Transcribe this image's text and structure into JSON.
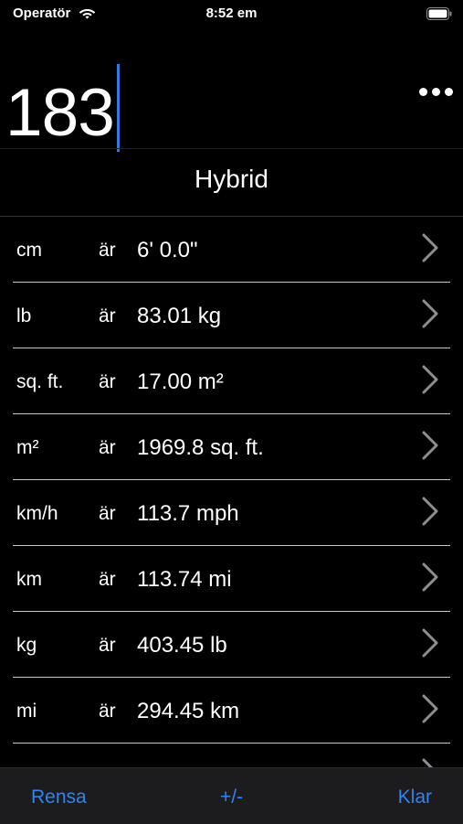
{
  "status_bar": {
    "carrier": "Operatör",
    "time": "8:52 em"
  },
  "input": {
    "value": "183"
  },
  "mode": {
    "title": "Hybrid"
  },
  "conversions": [
    {
      "unit": "cm",
      "is": "är",
      "result": "6' 0.0\""
    },
    {
      "unit": "lb",
      "is": "är",
      "result": "83.01 kg"
    },
    {
      "unit": "sq. ft.",
      "is": "är",
      "result": "17.00 m²"
    },
    {
      "unit": "m²",
      "is": "är",
      "result": "1969.8 sq. ft."
    },
    {
      "unit": "km/h",
      "is": "är",
      "result": "113.7 mph"
    },
    {
      "unit": "km",
      "is": "är",
      "result": "113.74 mi"
    },
    {
      "unit": "kg",
      "is": "är",
      "result": "403.45 lb"
    },
    {
      "unit": "mi",
      "is": "är",
      "result": "294.45 km"
    }
  ],
  "toolbar": {
    "clear_label": "Rensa",
    "sign_label": "+/-",
    "done_label": "Klar"
  },
  "colors": {
    "accent": "#2d84f5",
    "caret": "#2f7be5",
    "background": "#000000",
    "toolbar_bg": "#1c1c1e"
  }
}
